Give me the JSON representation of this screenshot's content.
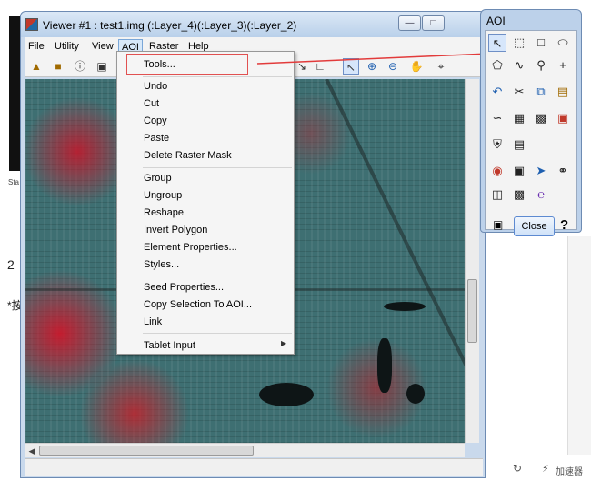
{
  "background": {
    "side_label": "Sta",
    "number": "2",
    "asterisk": "*按"
  },
  "viewer": {
    "title": "Viewer #1 : test1.img (:Layer_4)(:Layer_3)(:Layer_2)",
    "menus": [
      "File",
      "Utility",
      "View",
      "AOI",
      "Raster",
      "Help"
    ],
    "minimize_symbol": "—",
    "maximize_symbol": "□"
  },
  "aoi_menu": {
    "items": [
      "Tools...",
      "Undo",
      "Cut",
      "Copy",
      "Paste",
      "Delete Raster Mask",
      "Group",
      "Ungroup",
      "Reshape",
      "Invert Polygon",
      "Element Properties...",
      "Styles...",
      "Seed Properties...",
      "Copy Selection To AOI...",
      "Link",
      "Tablet Input"
    ],
    "submenu_arrow": "▶"
  },
  "aoi_palette": {
    "title": "AOI",
    "close_label": "Close",
    "help_label": "?"
  },
  "tray": {
    "accelerator_label": "加速器"
  },
  "colors": {
    "callout_red": "#e23b3b",
    "menu_highlight": "#d7e8f9"
  }
}
